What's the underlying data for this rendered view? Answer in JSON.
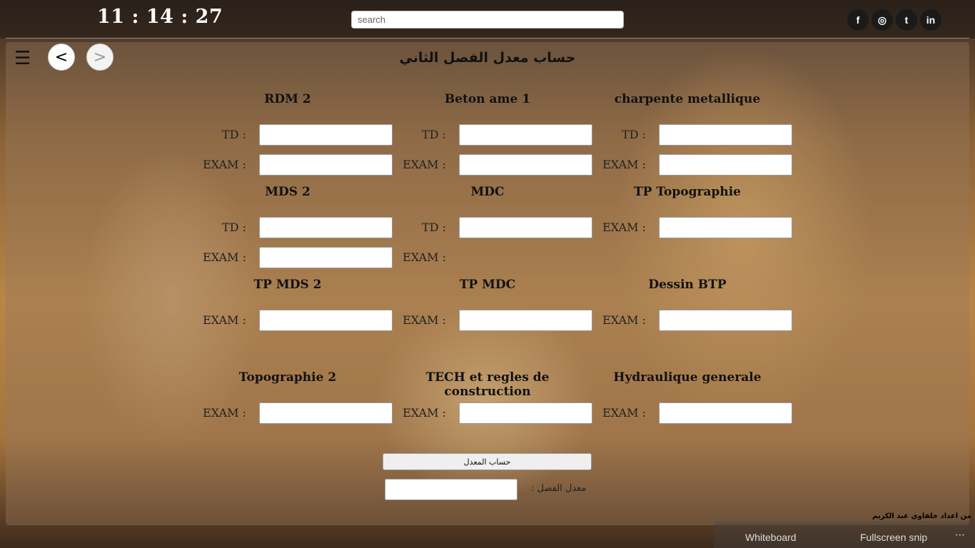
{
  "header": {
    "clock": "11 : 14 : 27",
    "search_placeholder": "search",
    "social": [
      {
        "name": "facebook-icon",
        "glyph": "f"
      },
      {
        "name": "instagram-icon",
        "glyph": "◎"
      },
      {
        "name": "twitter-icon",
        "glyph": "t"
      },
      {
        "name": "linkedin-icon",
        "glyph": "in"
      }
    ]
  },
  "nav": {
    "menu": "☰",
    "back": "<",
    "forward": ">"
  },
  "page_title": "حساب معدل الفصل الثاني",
  "labels": {
    "td": "TD :",
    "exam": "EXAM :"
  },
  "subjects": [
    {
      "name": "RDM 2",
      "fields": [
        "TD",
        "EXAM"
      ]
    },
    {
      "name": "Beton ame 1",
      "fields": [
        "TD",
        "EXAM"
      ]
    },
    {
      "name": "charpente metallique",
      "fields": [
        "TD",
        "EXAM"
      ]
    },
    {
      "name": "MDS 2",
      "fields": [
        "TD",
        "EXAM"
      ]
    },
    {
      "name": "MDC",
      "fields": [
        "TD",
        "EXAM"
      ]
    },
    {
      "name": "TP Topographie",
      "fields": [
        "EXAM"
      ]
    },
    {
      "name": "TP MDS 2",
      "fields": [
        "EXAM"
      ]
    },
    {
      "name": "TP MDC",
      "fields": [
        "EXAM"
      ]
    },
    {
      "name": "Dessin BTP",
      "fields": [
        "EXAM"
      ]
    },
    {
      "name": "Topographie 2",
      "fields": [
        "EXAM"
      ]
    },
    {
      "name": "TECH et regles de construction",
      "fields": [
        "EXAM"
      ]
    },
    {
      "name": "Hydraulique generale",
      "fields": [
        "EXAM"
      ]
    }
  ],
  "calculate_button": "حساب المعدل",
  "result_label": "معدل الفصل :",
  "footer_credit": "من اعداد خلفاوي عبد الكريم",
  "snip_bar": {
    "whiteboard": "Whiteboard",
    "fullscreen": "Fullscreen snip",
    "more": "⋯"
  }
}
